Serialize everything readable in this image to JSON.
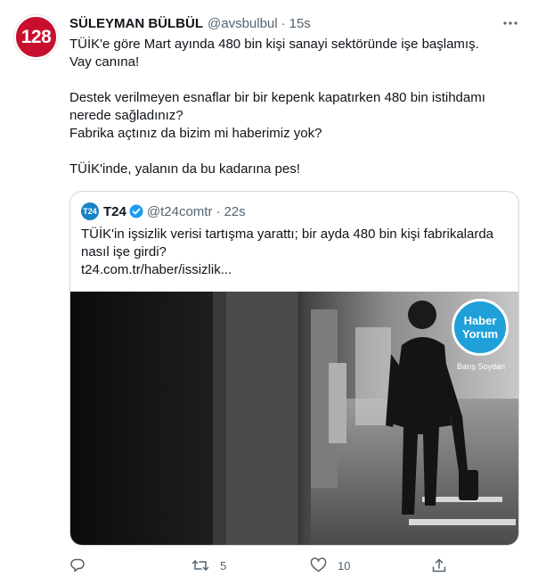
{
  "tweet": {
    "avatar_text": "128",
    "display_name": "SÜLEYMAN BÜLBÜL",
    "handle": "@avsbulbul",
    "separator": "·",
    "time": "15s",
    "lines": [
      "TÜİK'e göre Mart ayında 480 bin kişi sanayi sektöründe işe başlamış.",
      "Vay canına!",
      "Destek verilmeyen esnaflar bir bir kepenk kapatırken 480 bin istihdamı",
      "nerede sağladınız?",
      "Fabrika açtınız da bizim mi haberimiz yok?",
      "TÜİK'inde, yalanın da bu kadarına pes!"
    ]
  },
  "quote": {
    "avatar_text": "T24",
    "display_name": "T24",
    "handle": "@t24comtr",
    "separator": "·",
    "time": "22s",
    "text": "TÜİK'in işsizlik verisi tartışma yarattı; bir ayda 480 bin kişi fabrikalarda nasıl işe girdi?",
    "link": "t24.com.tr/haber/issizlik...",
    "image_badge": {
      "line1": "Haber",
      "line2": "Yorum",
      "author": "Barış Soydan"
    }
  },
  "actions": {
    "reply_count": "",
    "retweet_count": "5",
    "like_count": "10"
  },
  "colors": {
    "accent": "#1d9bf0",
    "muted": "#536471",
    "avatar": "#c8102e",
    "badge": "#1fa0d8"
  }
}
